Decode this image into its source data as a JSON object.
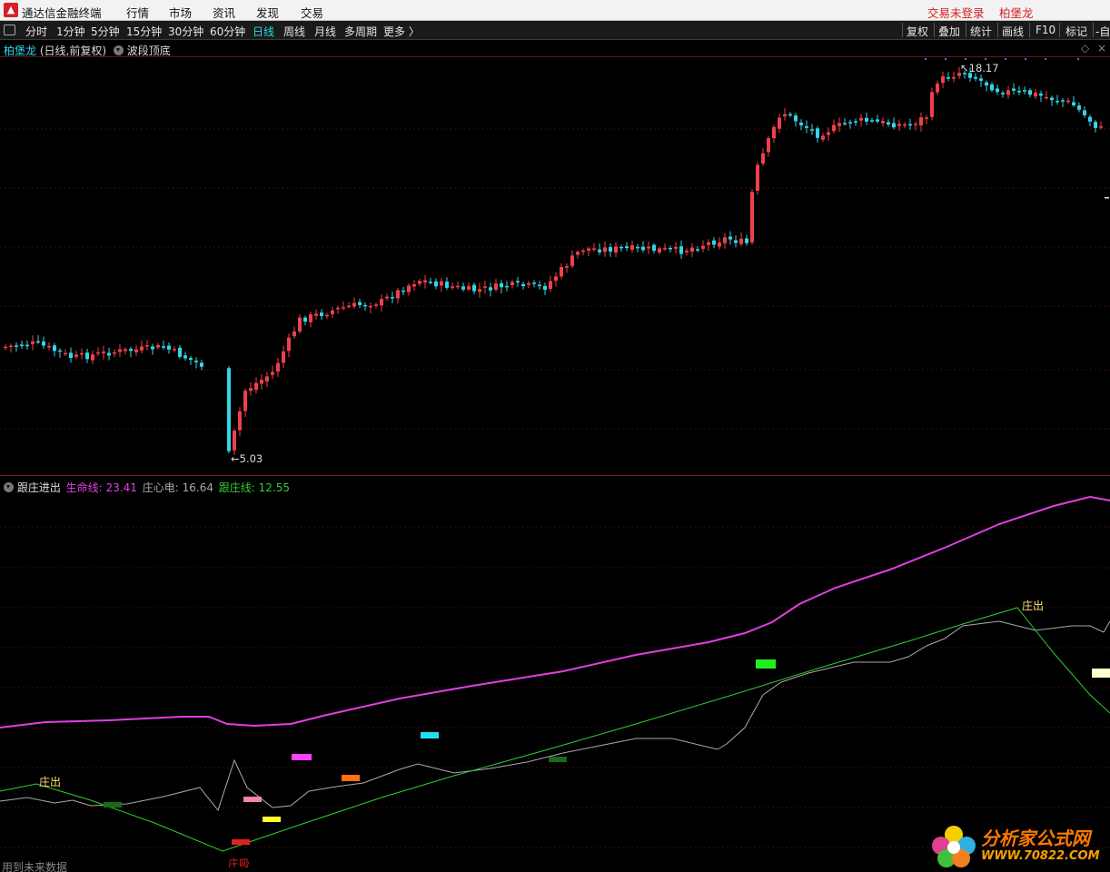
{
  "app": {
    "title": "通达信金融终端",
    "menu": [
      "行情",
      "市场",
      "资讯",
      "发现",
      "交易"
    ],
    "login_status": "交易未登录",
    "user_name": "柏堡龙"
  },
  "toolbar": {
    "periods": [
      "分时",
      "1分钟",
      "5分钟",
      "15分钟",
      "30分钟",
      "60分钟",
      "日线",
      "周线",
      "月线",
      "多周期",
      "更多 〉"
    ],
    "active_period": "日线",
    "right_buttons": [
      "复权",
      "叠加",
      "统计",
      "画线",
      "F10",
      "标记",
      "-自"
    ]
  },
  "main_panel": {
    "stock_name": "柏堡龙",
    "mode": "(日线,前复权)",
    "indicator": "波段顶底",
    "high_label": "18.17",
    "low_label": "5.03",
    "diamond_icon": "◇",
    "close_icon": "×"
  },
  "sub_panel": {
    "indicator_name": "跟庄进出",
    "lines": [
      {
        "name": "生命线:",
        "value": "23.41",
        "color": "#e040e0"
      },
      {
        "name": "庄心电:",
        "value": "16.64",
        "color": "#aaaaaa"
      },
      {
        "name": "跟庄线:",
        "value": "12.55",
        "color": "#33cc33"
      }
    ],
    "annotations": {
      "exit_left": "庄出",
      "absorb": "庄吸",
      "exit_right": "庄出"
    }
  },
  "status_text": "用到未来数据",
  "watermark": {
    "text": "分析家公式网",
    "url": "WWW.70822.COM"
  },
  "colors": {
    "up": "#f0404a",
    "down": "#33d6e6",
    "accent": "#2ed6e6",
    "life": "#e040e0",
    "follow": "#33cc33",
    "heart": "#aaaaaa"
  }
}
